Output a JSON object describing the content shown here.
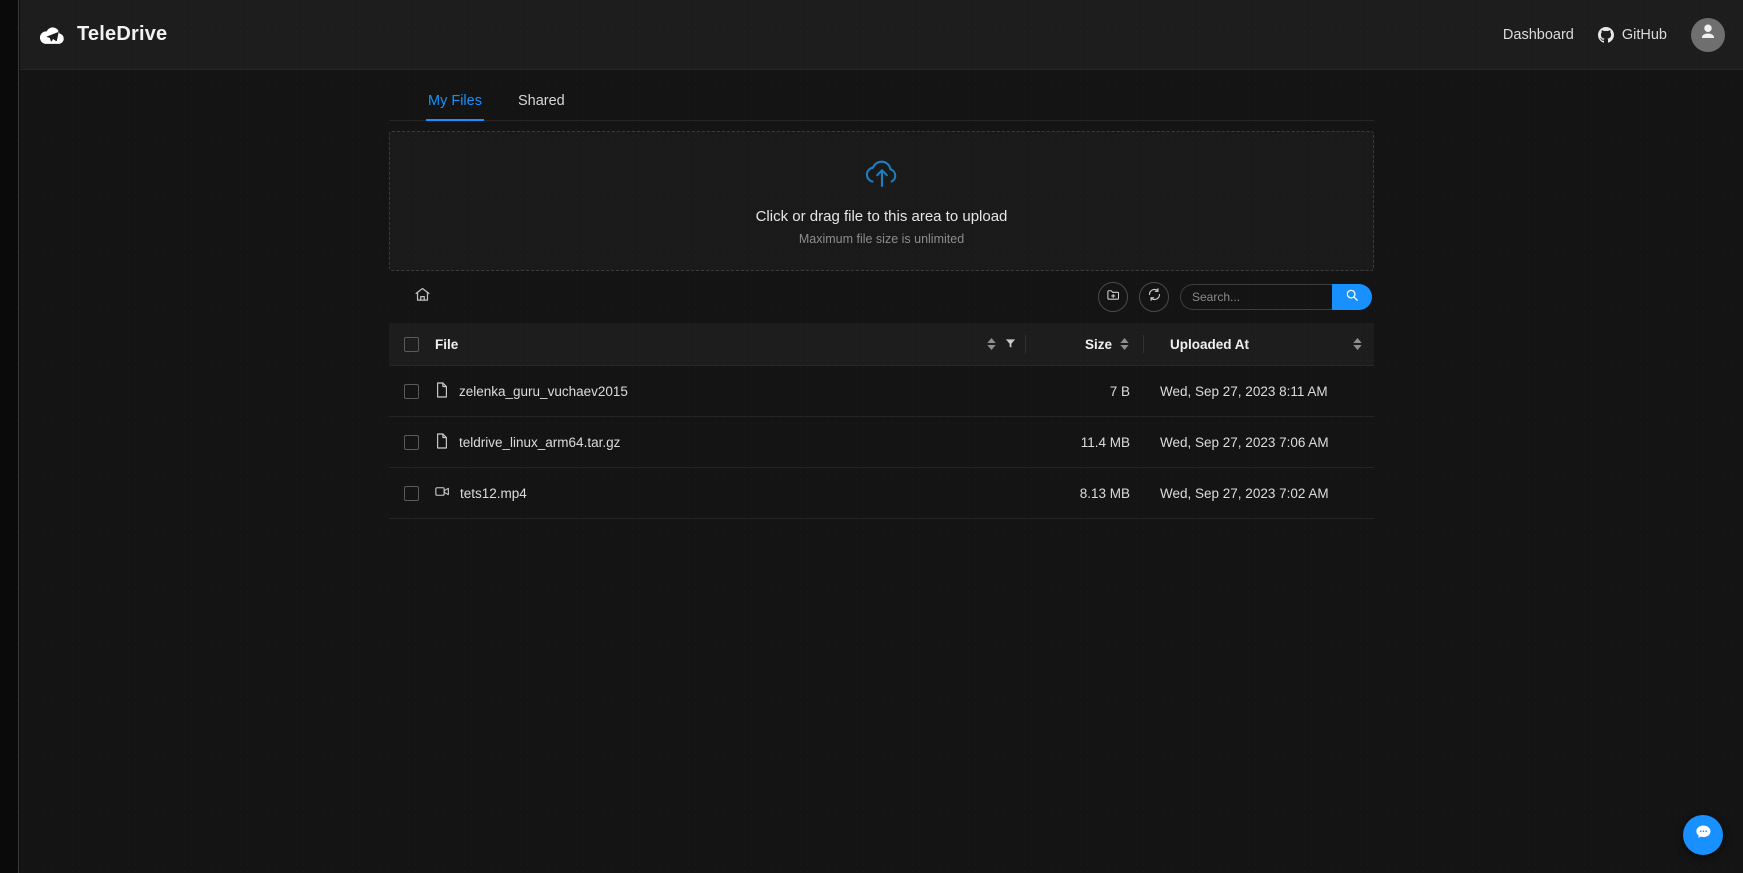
{
  "header": {
    "brand": "TeleDrive",
    "brand_logo_icon": "cloud-paperplane-icon",
    "dashboard_label": "Dashboard",
    "github_label": "GitHub",
    "github_icon": "github-icon",
    "avatar_icon": "user-avatar-icon"
  },
  "tabs": [
    {
      "label": "My Files",
      "active": true
    },
    {
      "label": "Shared",
      "active": false
    }
  ],
  "upload": {
    "icon": "cloud-upload-icon",
    "title": "Click or drag file to this area to upload",
    "hint": "Maximum file size is unlimited",
    "accent_color": "#1890ff"
  },
  "toolbar": {
    "home_icon": "home-icon",
    "new_folder_icon": "folder-add-icon",
    "refresh_icon": "refresh-icon",
    "search_placeholder": "Search...",
    "search_value": "",
    "search_icon": "search-icon",
    "search_button_color": "#1890ff"
  },
  "table": {
    "columns": [
      {
        "key": "check",
        "label": ""
      },
      {
        "key": "file",
        "label": "File"
      },
      {
        "key": "size",
        "label": "Size"
      },
      {
        "key": "date",
        "label": "Uploaded At"
      }
    ],
    "rows": [
      {
        "name": "zelenka_guru_vuchaev2015",
        "icon": "file-icon",
        "size": "7 B",
        "uploaded_at": "Wed, Sep 27, 2023 8:11 AM"
      },
      {
        "name": "teldrive_linux_arm64.tar.gz",
        "icon": "file-icon",
        "size": "11.4 MB",
        "uploaded_at": "Wed, Sep 27, 2023 7:06 AM"
      },
      {
        "name": "tets12.mp4",
        "icon": "video-icon",
        "size": "8.13 MB",
        "uploaded_at": "Wed, Sep 27, 2023 7:02 AM"
      }
    ]
  },
  "fab": {
    "icon": "chat-bubble-icon",
    "color": "#1890ff"
  }
}
